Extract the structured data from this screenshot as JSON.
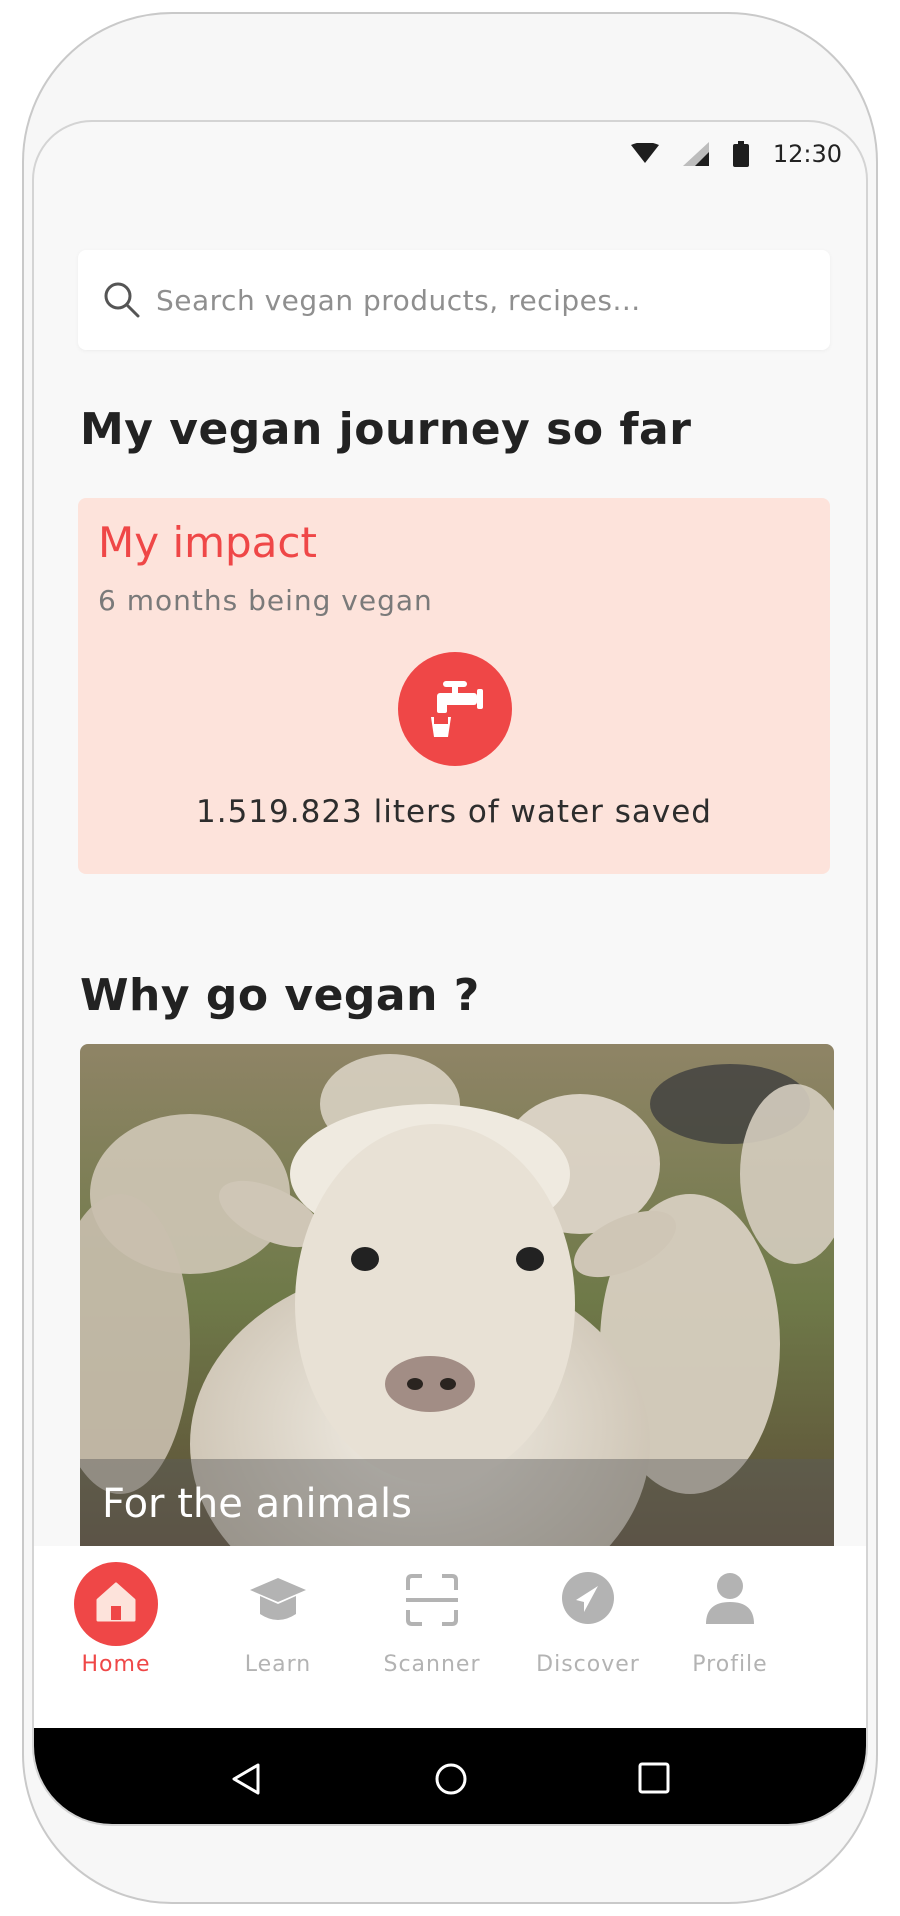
{
  "status": {
    "time": "12:30"
  },
  "search": {
    "placeholder": "Search vegan products, recipes..."
  },
  "journey": {
    "heading": "My vegan journey so far",
    "impact_title": "My impact",
    "impact_sub": "6 months being vegan",
    "impact_icon": "water-tap-icon",
    "impact_value": "1.519.823 liters of water saved"
  },
  "why": {
    "heading": "Why go vegan ?",
    "card_caption": "For the animals"
  },
  "tabs": [
    {
      "label": "Home",
      "icon": "home-icon",
      "active": true
    },
    {
      "label": "Learn",
      "icon": "graduation-cap-icon",
      "active": false
    },
    {
      "label": "Scanner",
      "icon": "scanner-icon",
      "active": false
    },
    {
      "label": "Discover",
      "icon": "compass-icon",
      "active": false
    },
    {
      "label": "Profile",
      "icon": "profile-icon",
      "active": false
    }
  ],
  "colors": {
    "accent": "#ef4747",
    "impact_bg": "#fde3db"
  }
}
